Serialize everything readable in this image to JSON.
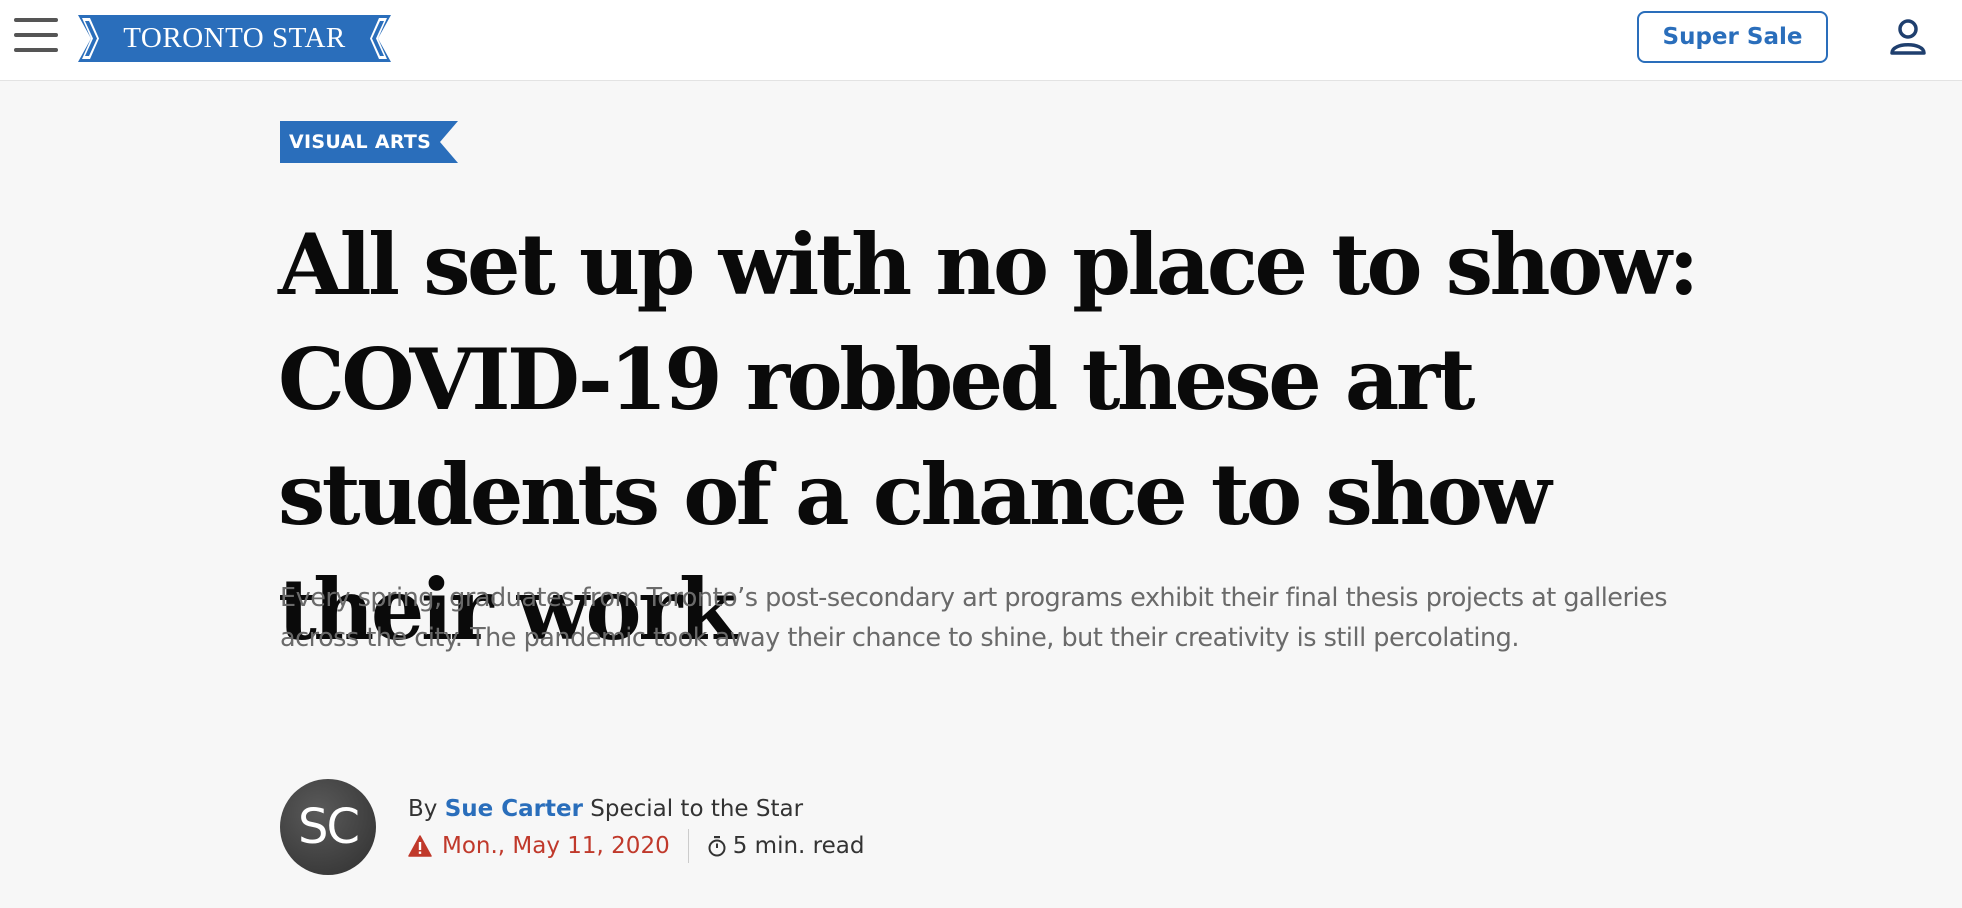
{
  "header": {
    "brand": "TORONTO STAR",
    "super_sale_label": "Super Sale",
    "menu_icon": "hamburger-menu-icon",
    "account_icon": "user-account-icon",
    "brand_color": "#2a6ebb"
  },
  "article": {
    "section_tag": "VISUAL ARTS",
    "headline": "All set up with no place to show: COVID-19 robbed these art students of a chance to show their work",
    "dek": "Every spring, graduates from Toronto’s post-secondary art programs exhibit their final thesis projects at galleries across the city. The pandemic took away their chance to shine, but their creativity is still percolating.",
    "byline": {
      "avatar_initials": "SC",
      "by_prefix": "By",
      "author": "Sue Carter",
      "affiliation": "Special to the Star",
      "date": "Mon., May 11, 2020",
      "date_icon": "warning-icon",
      "read_time": "5 min. read",
      "read_time_icon": "stopwatch-icon",
      "date_color": "#c0392b"
    }
  }
}
